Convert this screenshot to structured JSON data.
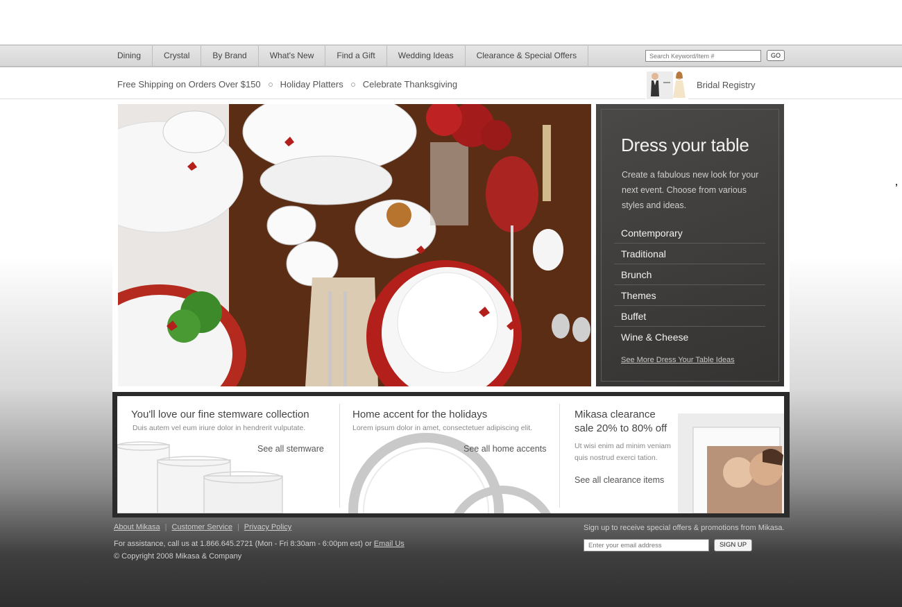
{
  "nav": {
    "items": [
      "Dining",
      "Crystal",
      "By Brand",
      "What's New",
      "Find a Gift",
      "Wedding Ideas",
      "Clearance & Special Offers"
    ],
    "search_placeholder": "Search Keyword/Item #",
    "go_label": "GO"
  },
  "promo": {
    "links": [
      "Free Shipping on Orders Over $150",
      "Holiday Platters",
      "Celebrate Thanksgiving"
    ],
    "bridal": "Bridal Registry"
  },
  "dress": {
    "title": "Dress your table",
    "description": "Create a fabulous new look for your next event. Choose from various styles and ideas.",
    "items": [
      "Contemporary",
      "Traditional",
      "Brunch",
      "Themes",
      "Buffet",
      "Wine & Cheese"
    ],
    "more": "See More Dress Your Table Ideas"
  },
  "features": [
    {
      "title": "You'll love our fine stemware collection",
      "sub": "Duis autem vel eum iriure dolor in hendrerit vulputate.",
      "link": "See all stemware"
    },
    {
      "title": "Home accent for the holidays",
      "sub": "Lorem ipsum dolor in amet, consectetuer adipiscing elit.",
      "link": "See all home accents"
    },
    {
      "title_line1": "Mikasa clearance",
      "title_line2": "sale 20% to 80% off",
      "sub_line1": "Ut wisi enim ad minim veniam",
      "sub_line2": "quis nostrud exerci tation.",
      "link": "See all clearance items"
    }
  ],
  "footer": {
    "links": [
      "About Mikasa",
      "Customer Service",
      "Privacy Policy"
    ],
    "assist_text": "For assistance, call us at 1.866.645.2721 (Mon - Fri 8:30am - 6:00pm est) or ",
    "email_us": "Email Us",
    "copyright": "© Copyright 2008 Mikasa & Company",
    "signup_text": "Sign up to receive special offers & promotions from Mikasa.",
    "email_placeholder": "Enter your email address",
    "signup_label": "SIGN UP"
  },
  "colors": {
    "accent_red": "#b3201b",
    "dark_panel": "#3f3d3b",
    "nav_bg": "#dcdcdc"
  }
}
